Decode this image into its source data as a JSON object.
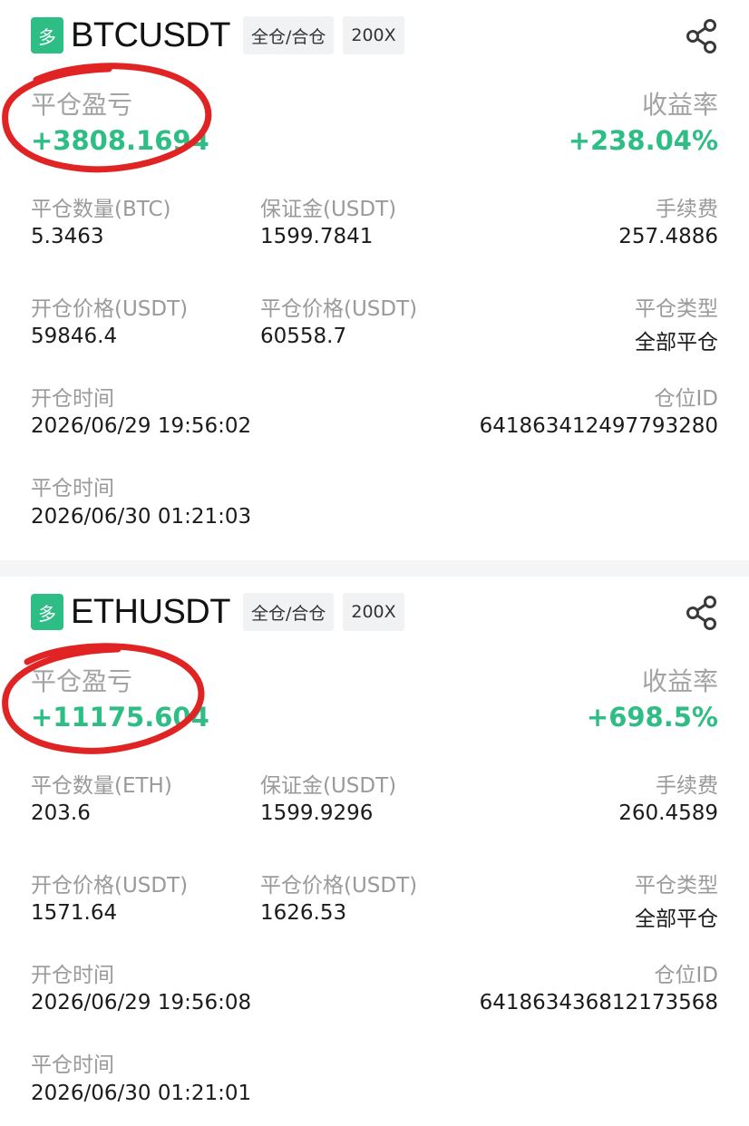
{
  "cards": [
    {
      "side": "多",
      "symbol": "BTCUSDT",
      "margin_mode": "全仓/合仓",
      "leverage": "200X",
      "pnl_label": "平仓盈亏",
      "pnl_value": "+3808.1694",
      "roi_label": "收益率",
      "roi_value": "+238.04%",
      "qty_label": "平仓数量(BTC)",
      "qty_value": "5.3463",
      "margin_label": "保证金(USDT)",
      "margin_value": "1599.7841",
      "fee_label": "手续费",
      "fee_value": "257.4886",
      "open_price_label": "开仓价格(USDT)",
      "open_price_value": "59846.4",
      "close_price_label": "平仓价格(USDT)",
      "close_price_value": "60558.7",
      "close_type_label": "平仓类型",
      "close_type_value": "全部平仓",
      "open_time_label": "开仓时间",
      "open_time_value": "2026/06/29 19:56:02",
      "position_id_label": "仓位ID",
      "position_id_value": "641863412497793280",
      "close_time_label": "平仓时间",
      "close_time_value": "2026/06/30 01:21:03"
    },
    {
      "side": "多",
      "symbol": "ETHUSDT",
      "margin_mode": "全仓/合仓",
      "leverage": "200X",
      "pnl_label": "平仓盈亏",
      "pnl_value": "+11175.604",
      "roi_label": "收益率",
      "roi_value": "+698.5%",
      "qty_label": "平仓数量(ETH)",
      "qty_value": "203.6",
      "margin_label": "保证金(USDT)",
      "margin_value": "1599.9296",
      "fee_label": "手续费",
      "fee_value": "260.4589",
      "open_price_label": "开仓价格(USDT)",
      "open_price_value": "1571.64",
      "close_price_label": "平仓价格(USDT)",
      "close_price_value": "1626.53",
      "close_type_label": "平仓类型",
      "close_type_value": "全部平仓",
      "open_time_label": "开仓时间",
      "open_time_value": "2026/06/29 19:56:08",
      "position_id_label": "仓位ID",
      "position_id_value": "641863436812173568",
      "close_time_label": "平仓时间",
      "close_time_value": "2026/06/30 01:21:01"
    }
  ],
  "icons": {
    "share": "share-icon",
    "annotation": "red-hand-drawn-circle"
  },
  "colors": {
    "profit_green": "#2ebd85",
    "annotation_red": "#e02424"
  }
}
